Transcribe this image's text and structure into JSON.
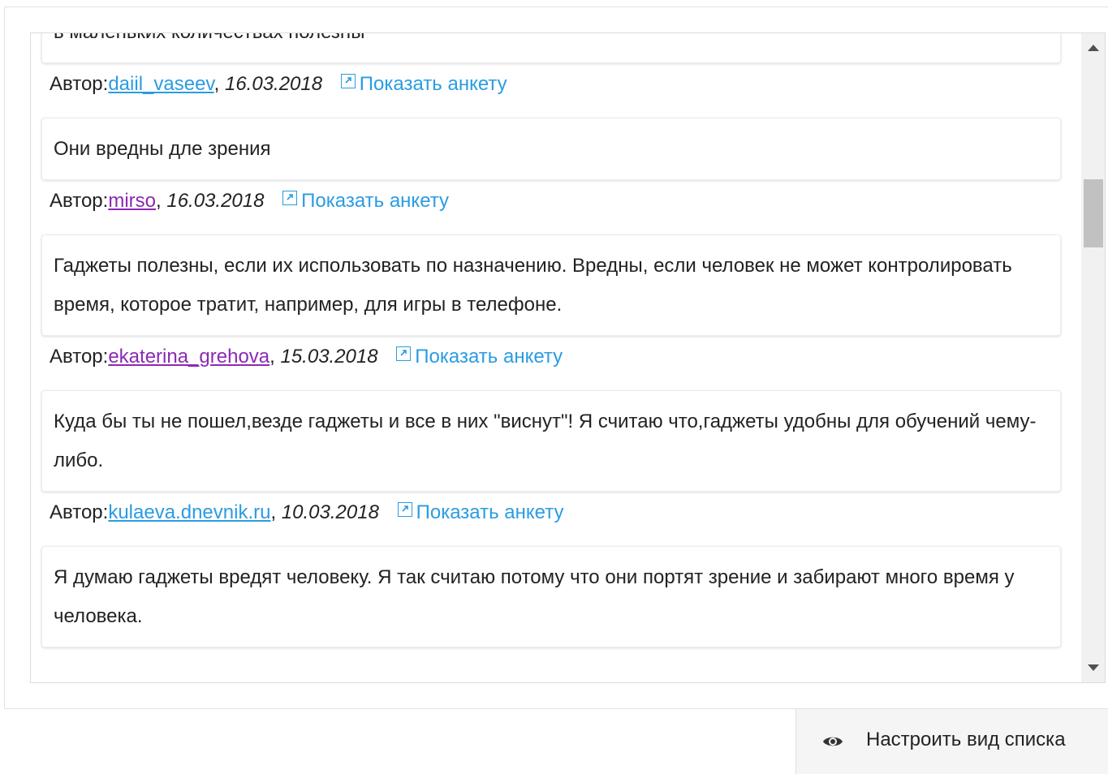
{
  "comments": [
    {
      "text": "в маленьких количествах полезны",
      "author_prefix": "Автор:",
      "author": "daiil_vaseev",
      "author_visited": false,
      "date": "16.03.2018",
      "show_profile": "Показать анкету"
    },
    {
      "text": "Они вредны дле зрения",
      "author_prefix": "Автор:",
      "author": "mirso",
      "author_visited": true,
      "date": "16.03.2018",
      "show_profile": "Показать анкету"
    },
    {
      "text": "Гаджеты полезны, если их использовать по назначению. Вредны, если человек не может контролировать время, которое тратит, например, для игры в телефоне.",
      "author_prefix": "Автор:",
      "author": "ekaterina_grehova",
      "author_visited": true,
      "date": "15.03.2018",
      "show_profile": "Показать анкету"
    },
    {
      "text": "Куда бы ты не пошел,везде гаджеты и все в них \"виснут\"! Я считаю что,гаджеты удобны для обучений чему-либо.",
      "author_prefix": "Автор:",
      "author": "kulaeva.dnevnik.ru",
      "author_visited": false,
      "date": "10.03.2018",
      "show_profile": "Показать анкету"
    },
    {
      "text": "Я думаю гаджеты вредят человеку. Я так считаю потому что они портят зрение и забирают много время у человека."
    }
  ],
  "footer": {
    "configure_view": "Настроить вид списка",
    "configure_icon": "eye-icon"
  },
  "colors": {
    "link": "#2a9ce2",
    "visited_link": "#8c29b3"
  }
}
